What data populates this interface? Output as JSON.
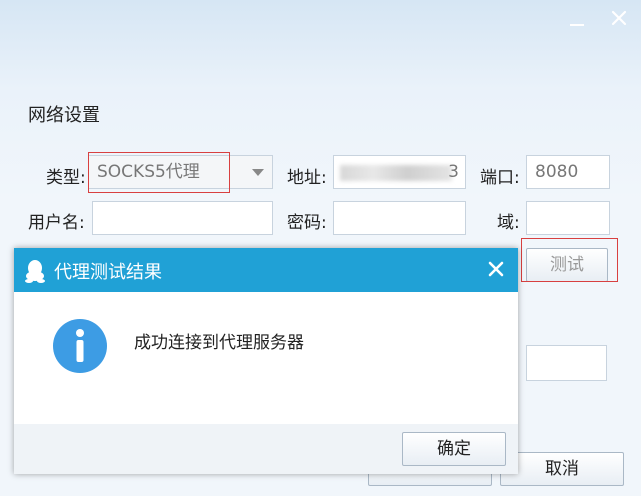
{
  "window": {
    "minimize_icon": "minimize-icon",
    "close_icon": "close-icon"
  },
  "section_title": "网络设置",
  "form": {
    "type_label": "类型:",
    "type_value": "SOCKS5代理",
    "address_label": "地址:",
    "address_value_tail": "3",
    "port_label": "端口:",
    "port_value": "8080",
    "username_label": "用户名:",
    "username_value": "",
    "password_label": "密码:",
    "password_value": "",
    "domain_label": "域:",
    "domain_value": "",
    "test_button": "测试",
    "cancel_button": "取消"
  },
  "dialog": {
    "title": "代理测试结果",
    "message": "成功连接到代理服务器",
    "ok_button": "确定",
    "header_color": "#20a1d6",
    "icon_color": "#3d9ce4"
  }
}
